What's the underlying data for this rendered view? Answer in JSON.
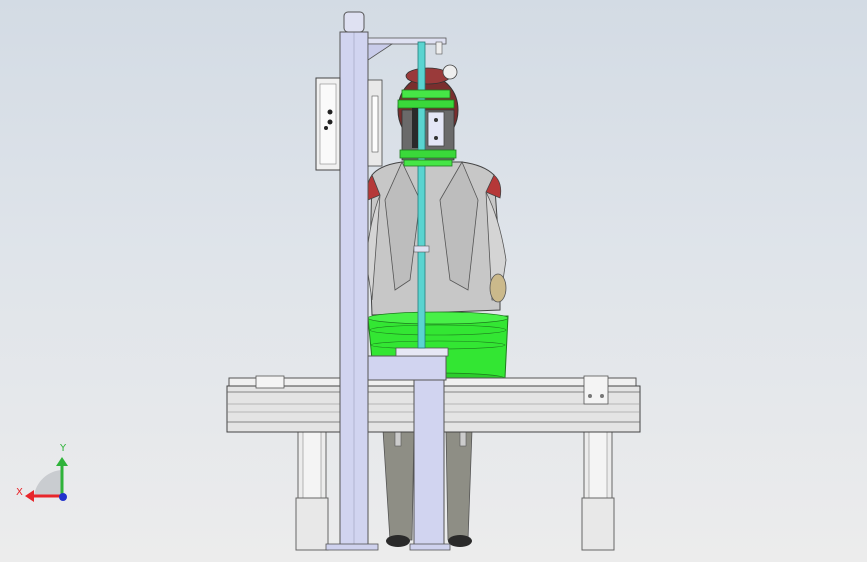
{
  "viewport": {
    "background_top": "#d3dbe4",
    "background_bottom": "#ececec"
  },
  "triad": {
    "x_label": "X",
    "y_label": "Y",
    "x_color": "#e8262b",
    "y_color": "#2fb33a",
    "z_color": "#2233cc"
  },
  "colors": {
    "frame": "#d3d6f0",
    "rod": "#5bd6d2",
    "green_part": "#3be83b",
    "jacket": "#c9c9c9",
    "shoulder": "#b93a3a",
    "trousers": "#8f8f86",
    "skin": "#c9b88a",
    "conveyor": "#e3e3e3"
  }
}
